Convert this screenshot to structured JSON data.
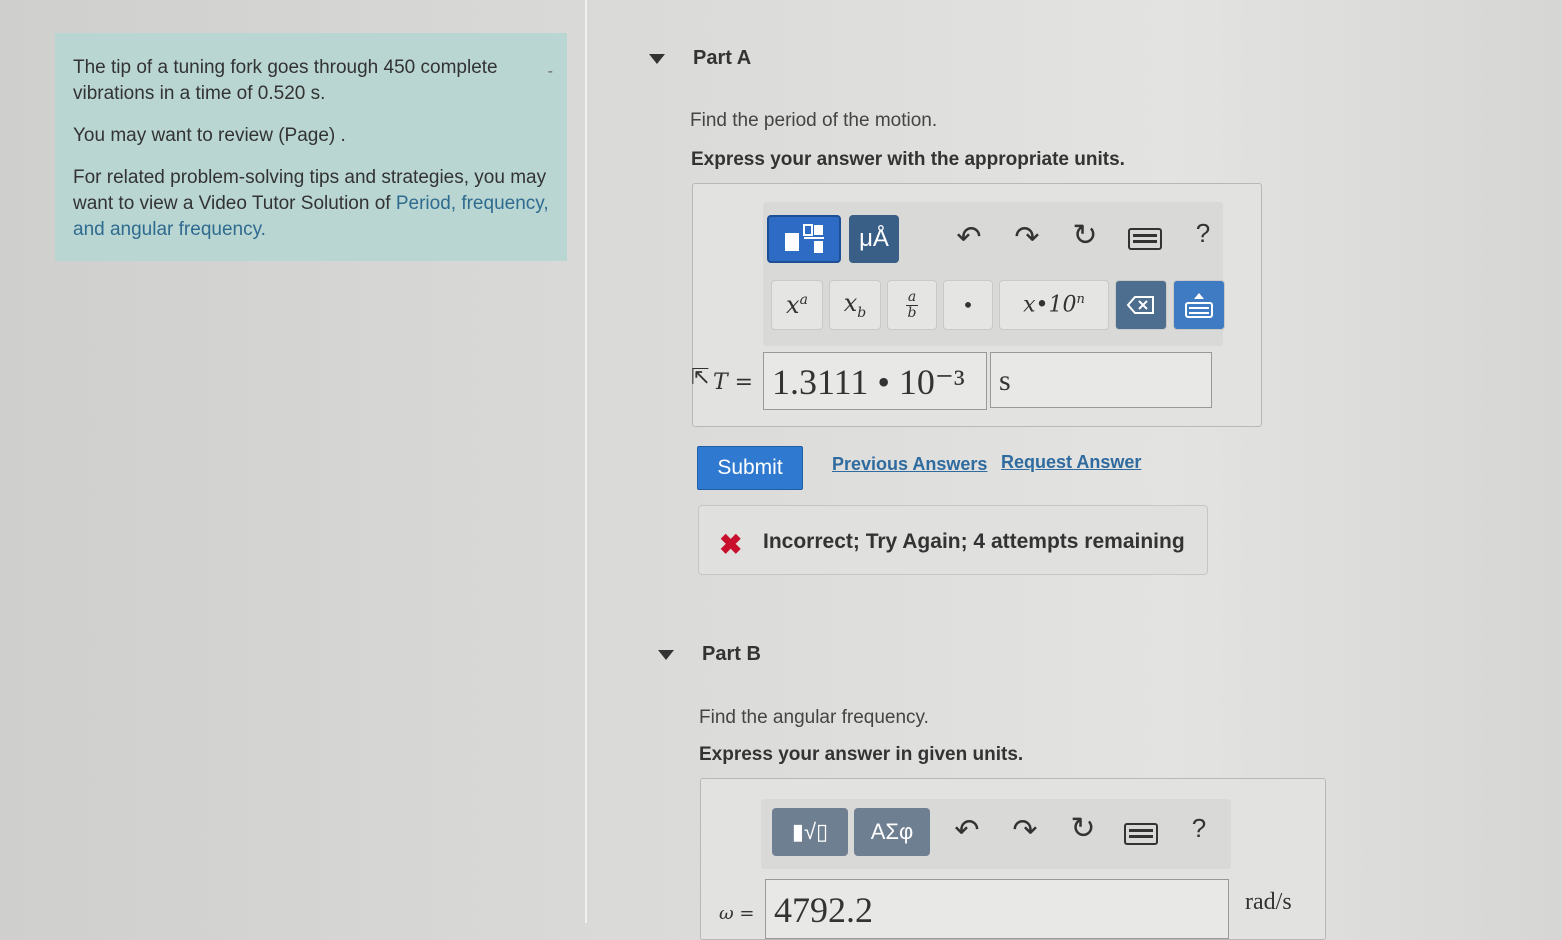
{
  "sidebar": {
    "paragraph1": "The tip of a tuning fork goes through 450 complete vibrations in a time of 0.520 s.",
    "paragraph2": "You may want to review (Page) .",
    "paragraph3_prefix": "For related problem-solving tips and strategies, you may want to view a Video Tutor Solution of ",
    "paragraph3_link": "Period, frequency, and angular frequency.",
    "collapse": "-"
  },
  "partA": {
    "title": "Part A",
    "question": "Find the period of the motion.",
    "instruction": "Express your answer with the appropriate units.",
    "toolbar": {
      "units_label": "μÅ",
      "help_label": "?"
    },
    "keys": {
      "power": "xa",
      "subscript": "xb",
      "fraction": "a/b",
      "dot": "•",
      "sci": "x•10n"
    },
    "variable": "T =",
    "answer_value": "1.3111 • 10⁻³",
    "answer_unit": "s",
    "submit_label": "Submit",
    "previous_answers": "Previous Answers",
    "request_answer": "Request Answer",
    "feedback": "Incorrect; Try Again; 4 attempts remaining"
  },
  "partB": {
    "title": "Part B",
    "question": "Find the angular frequency.",
    "instruction": "Express your answer in given units.",
    "toolbar": {
      "templates_label": "▮√▯",
      "symbols_label": "ΑΣφ",
      "help_label": "?"
    },
    "variable": "ω =",
    "answer_value": "4792.2",
    "answer_unit": "rad/s"
  }
}
